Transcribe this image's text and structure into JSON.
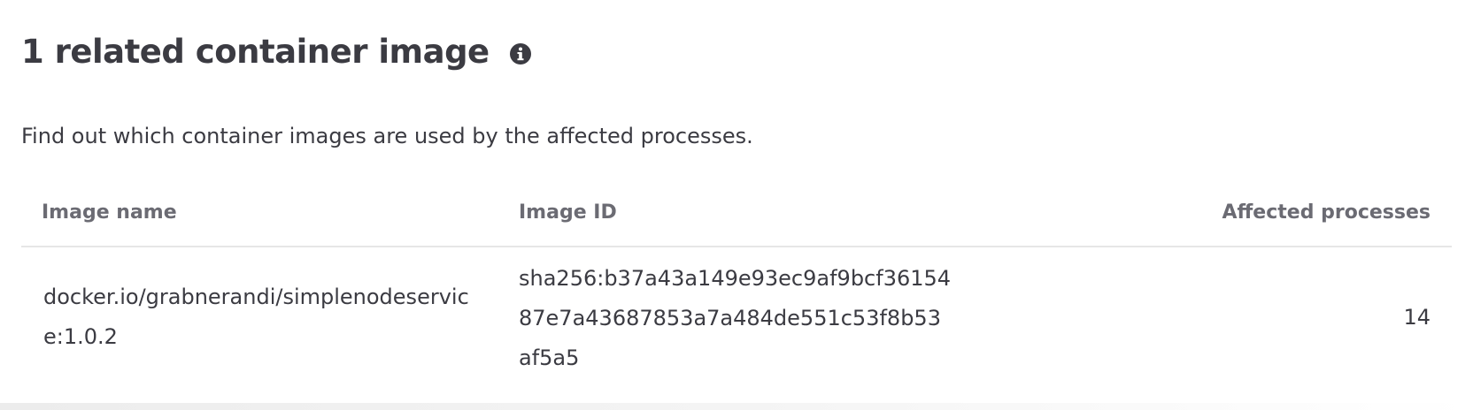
{
  "section": {
    "title": "1 related container image",
    "info_icon": "info-circle-icon",
    "description": "Find out which container images are used by the affected processes."
  },
  "table": {
    "columns": {
      "image_name": "Image name",
      "image_id": "Image ID",
      "affected_processes": "Affected processes"
    },
    "rows": [
      {
        "image_name": "docker.io/grabnerandi/simplenodeservice:1.0.2",
        "image_id": "sha256:b37a43a149e93ec9af9bcf3615487e7a43687853a7a484de551c53f8b53af5a5",
        "affected_processes": "14"
      }
    ]
  },
  "colors": {
    "text": "#3b3b42",
    "header_text": "#6b6b73",
    "divider": "#e6e6e6"
  }
}
